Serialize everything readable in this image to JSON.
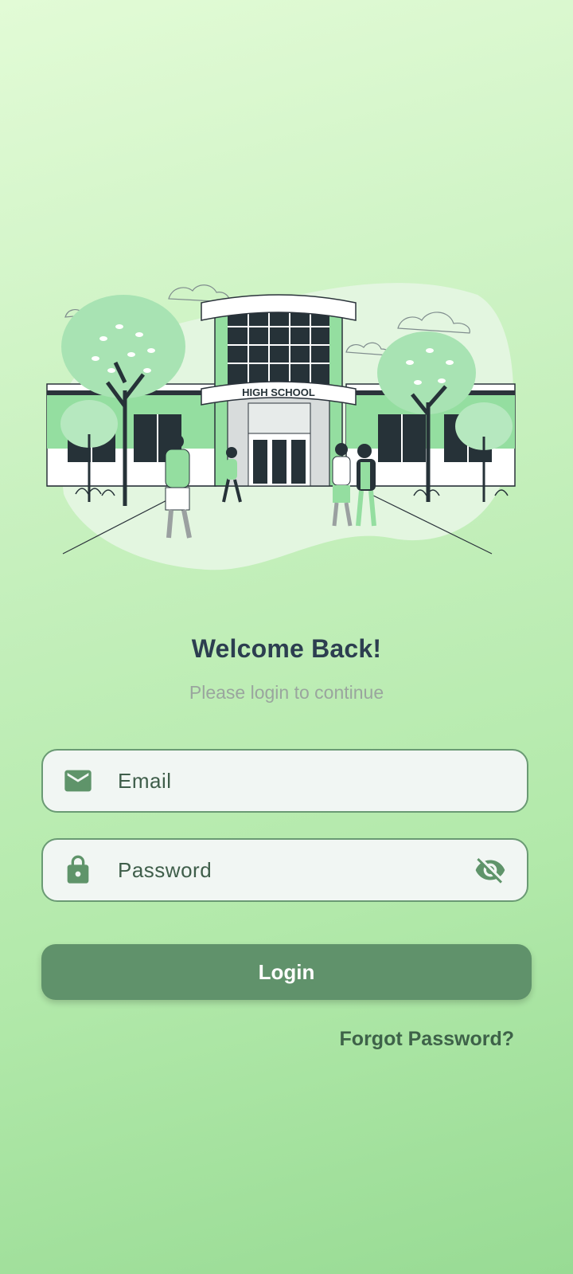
{
  "illustration": {
    "sign_text": "HIGH SCHOOL"
  },
  "header": {
    "title": "Welcome Back!",
    "subtitle": "Please login to continue"
  },
  "form": {
    "email": {
      "placeholder": "Email",
      "value": "",
      "icon": "mail-icon"
    },
    "password": {
      "placeholder": "Password",
      "value": "",
      "icon": "lock-icon",
      "toggle_icon": "visibility-off-icon"
    },
    "login_label": "Login",
    "forgot_label": "Forgot Password?"
  },
  "colors": {
    "accent": "#60926b",
    "title": "#2c3e50",
    "field_border": "#6a9a74",
    "field_bg": "#f1f6f3"
  }
}
